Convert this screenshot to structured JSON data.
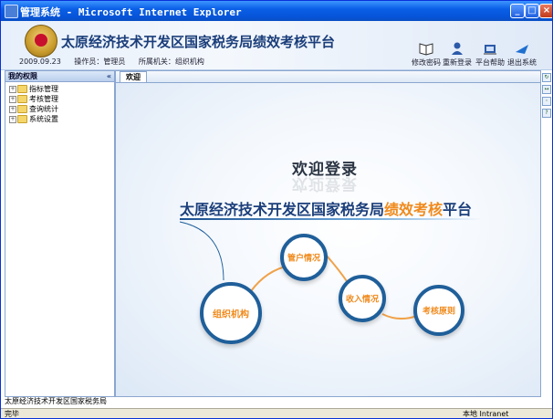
{
  "window": {
    "title": "管理系统 - Microsoft Internet Explorer",
    "minimize": "_",
    "maximize": "□",
    "close": "×"
  },
  "header": {
    "app_title": "太原经济技术开发区国家税务局绩效考核平台",
    "date": "2009.09.23",
    "operator": "操作员：管理员",
    "org": "所属机关：组织机构",
    "buttons": [
      {
        "label": "修改密码",
        "icon": "book-icon"
      },
      {
        "label": "重新登录",
        "icon": "users-icon"
      },
      {
        "label": "平台帮助",
        "icon": "help-icon"
      },
      {
        "label": "退出系统",
        "icon": "exit-icon"
      }
    ]
  },
  "sidebar": {
    "title": "我的权限",
    "collapse": "«",
    "items": [
      {
        "label": "指标管理"
      },
      {
        "label": "考核管理"
      },
      {
        "label": "查询统计"
      },
      {
        "label": "系统设置"
      }
    ]
  },
  "main": {
    "tab": "欢迎",
    "welcome": "欢迎登录",
    "platform_title_main": "太原经济技术开发区国家税务局",
    "platform_title_highlight": "绩效考核",
    "platform_title_tail": "平台",
    "circles": [
      "组织机构",
      "管户情况",
      "收入情况",
      "考核原则"
    ]
  },
  "footer": {
    "text": "太原经济技术开发区国家税务局"
  },
  "statusbar": {
    "left": "完毕",
    "right": "本地 Intranet"
  },
  "colors": {
    "accent": "#1b3e7a",
    "highlight": "#f08a1c",
    "circle_border": "#1f5f9a"
  }
}
